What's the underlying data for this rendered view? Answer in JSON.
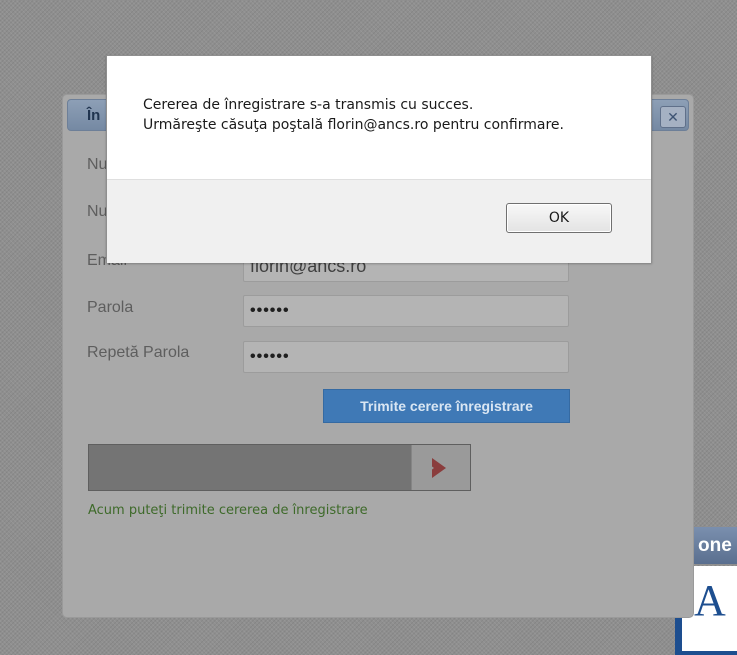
{
  "background": {
    "brand_text": "one",
    "logo_letter": "A"
  },
  "registration": {
    "title_partial": "În",
    "close_glyph": "✕",
    "fields": [
      {
        "label": "Nu",
        "value": ""
      },
      {
        "label": "Nu",
        "value": ""
      },
      {
        "label": "Email",
        "value": "florin@ancs.ro"
      },
      {
        "label": "Parola",
        "value": "••••••"
      },
      {
        "label": "Repetă Parola",
        "value": "••••••"
      }
    ],
    "submit_label": "Trimite cerere înregistrare",
    "hint": "Acum puteţi trimite cererea de înregistrare"
  },
  "message": {
    "line1": "Cererea de înregistrare s-a transmis cu succes.",
    "line2": "Urmăreşte căsuţa poştală florin@ancs.ro  pentru confirmare.",
    "ok_label": "OK"
  },
  "colors": {
    "submit_button": "#3f79b6",
    "hint_text": "#3e6a2a",
    "logo_blue": "#1d4e8f"
  }
}
